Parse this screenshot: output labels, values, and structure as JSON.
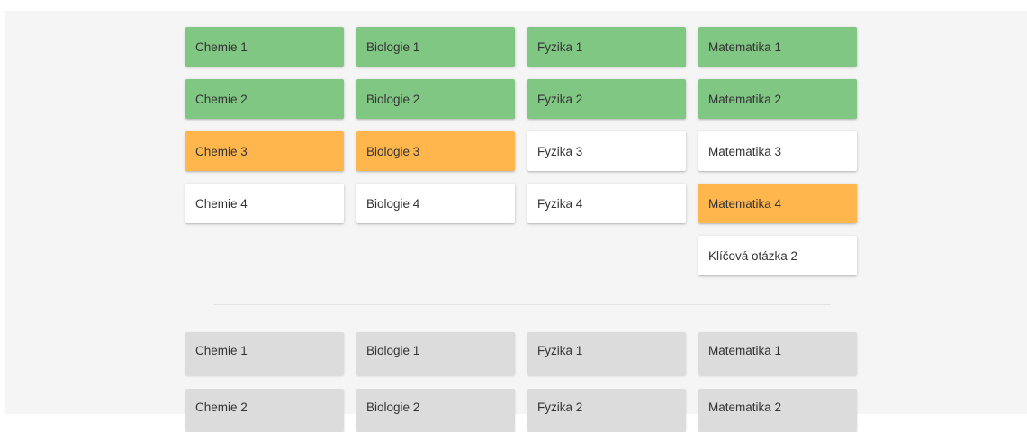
{
  "top_grid": [
    {
      "label": "Chemie 1",
      "state": "done"
    },
    {
      "label": "Biologie 1",
      "state": "done"
    },
    {
      "label": "Fyzika 1",
      "state": "done"
    },
    {
      "label": "Matematika 1",
      "state": "done"
    },
    {
      "label": "Chemie 2",
      "state": "done"
    },
    {
      "label": "Biologie 2",
      "state": "done"
    },
    {
      "label": "Fyzika 2",
      "state": "done"
    },
    {
      "label": "Matematika 2",
      "state": "done"
    },
    {
      "label": "Chemie 3",
      "state": "progress"
    },
    {
      "label": "Biologie 3",
      "state": "progress"
    },
    {
      "label": "Fyzika 3",
      "state": "todo"
    },
    {
      "label": "Matematika 3",
      "state": "todo"
    },
    {
      "label": "Chemie 4",
      "state": "todo"
    },
    {
      "label": "Biologie 4",
      "state": "todo"
    },
    {
      "label": "Fyzika 4",
      "state": "todo"
    },
    {
      "label": "Matematika 4",
      "state": "progress"
    },
    {
      "label": "Klíčová otázka 2",
      "state": "todo"
    }
  ],
  "bottom_grid": [
    {
      "label": "Chemie 1"
    },
    {
      "label": "Biologie 1"
    },
    {
      "label": "Fyzika 1"
    },
    {
      "label": "Matematika 1"
    },
    {
      "label": "Chemie 2"
    },
    {
      "label": "Biologie 2"
    },
    {
      "label": "Fyzika 2"
    },
    {
      "label": "Matematika 2"
    }
  ],
  "colors": {
    "done": "#81c784",
    "progress": "#ffb74d",
    "todo": "#ffffff",
    "disabled": "#dcdcdc",
    "page_background": "#f5f5f5"
  }
}
